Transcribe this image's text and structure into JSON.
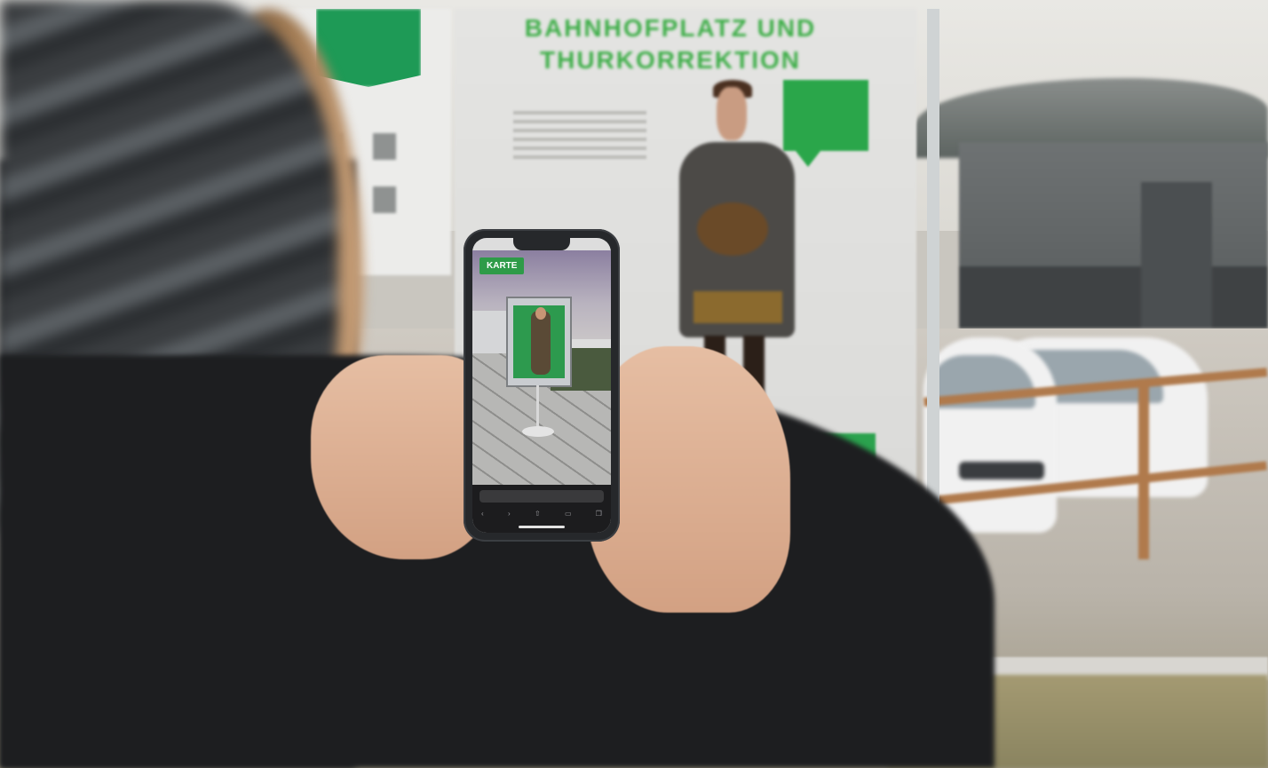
{
  "scene": {
    "poster_title_lines": [
      "BAHNHOFPLATZ UND",
      "THURKORREKTION"
    ],
    "phone": {
      "ar_button_label": "KARTE",
      "url": "",
      "status_time": ""
    }
  },
  "colors": {
    "poster_green": "#2ba24e",
    "coat": "#1d1e20",
    "phone_frame": "#26282b"
  },
  "icons": [
    "share-icon",
    "bookmark-icon",
    "tabs-icon",
    "back-icon",
    "forward-icon"
  ]
}
